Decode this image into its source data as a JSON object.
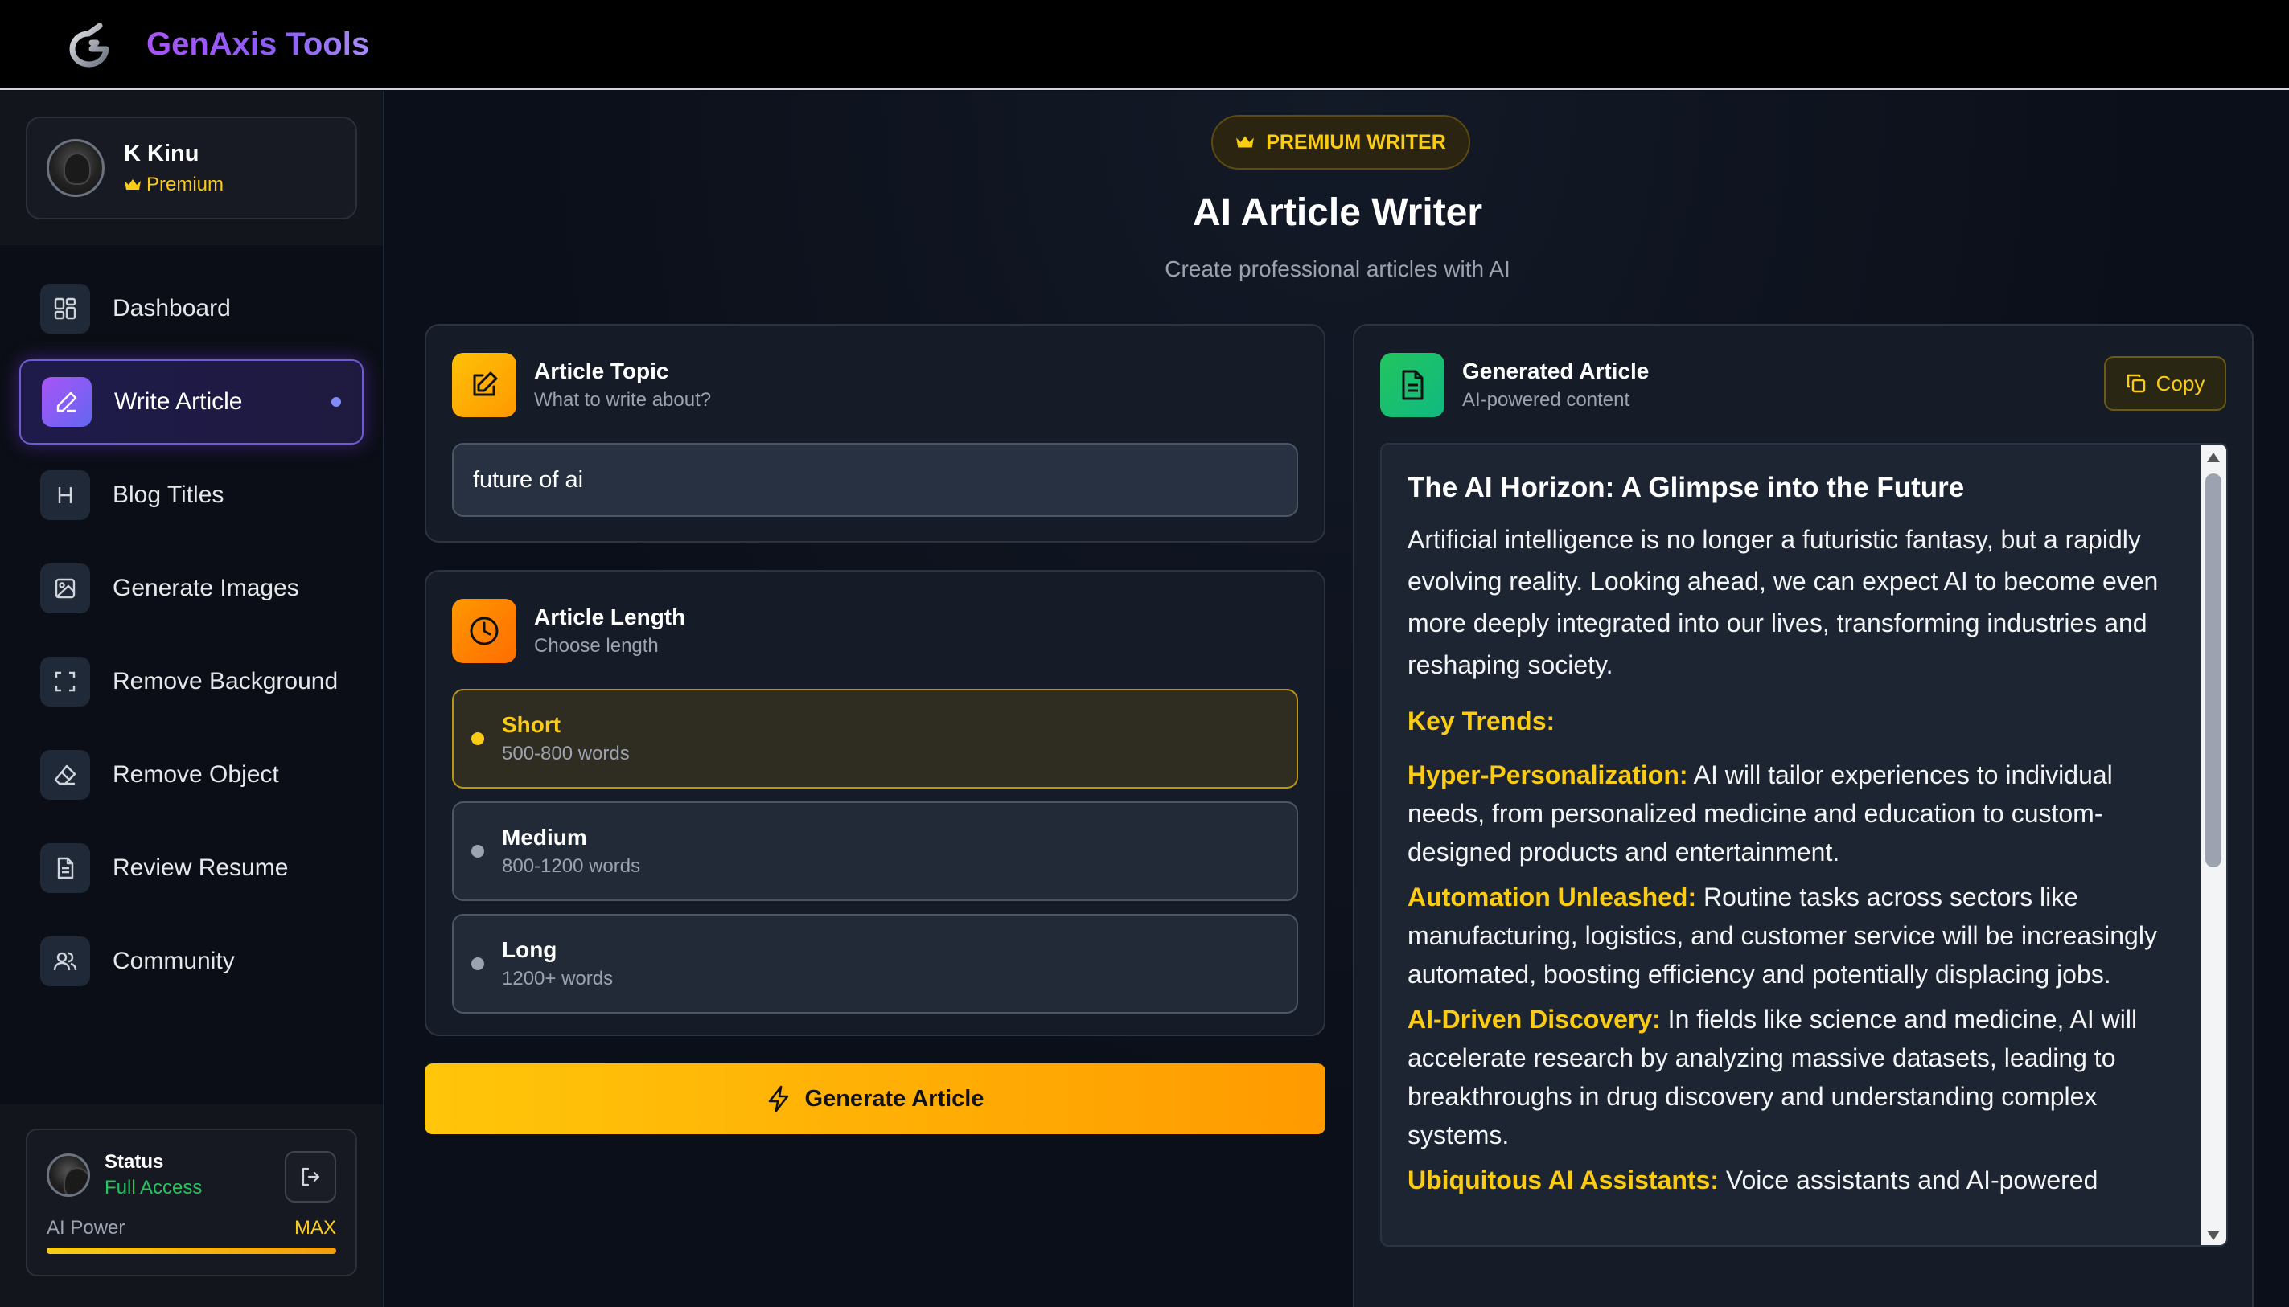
{
  "app": {
    "brand": "GenAxis Tools"
  },
  "profile": {
    "name": "K Kinu",
    "plan": "Premium"
  },
  "sidebar": {
    "items": [
      {
        "label": "Dashboard",
        "icon": "dashboard-icon"
      },
      {
        "label": "Write Article",
        "icon": "pen-icon",
        "active": true
      },
      {
        "label": "Blog Titles",
        "icon": "heading-icon"
      },
      {
        "label": "Generate Images",
        "icon": "image-icon"
      },
      {
        "label": "Remove Background",
        "icon": "scan-icon"
      },
      {
        "label": "Remove Object",
        "icon": "eraser-icon"
      },
      {
        "label": "Review Resume",
        "icon": "document-icon"
      },
      {
        "label": "Community",
        "icon": "users-icon"
      }
    ]
  },
  "status": {
    "title": "Status",
    "access": "Full Access",
    "power_label": "AI Power",
    "power_value": "MAX",
    "power_fill": 1.0
  },
  "header": {
    "badge": "PREMIUM WRITER",
    "title": "AI Article Writer",
    "subtitle": "Create professional articles with AI"
  },
  "topic": {
    "title": "Article Topic",
    "subtitle": "What to write about?",
    "value": "future of ai"
  },
  "length": {
    "title": "Article Length",
    "subtitle": "Choose length",
    "options": [
      {
        "name": "Short",
        "desc": "500-800 words",
        "selected": true
      },
      {
        "name": "Medium",
        "desc": "800-1200 words",
        "selected": false
      },
      {
        "name": "Long",
        "desc": "1200+ words",
        "selected": false
      }
    ]
  },
  "generate": {
    "label": "Generate Article"
  },
  "output": {
    "title": "Generated Article",
    "subtitle": "AI-powered content",
    "copy_label": "Copy",
    "article": {
      "heading": "The AI Horizon: A Glimpse into the Future",
      "intro": "Artificial intelligence is no longer a futuristic fantasy, but a rapidly evolving reality. Looking ahead, we can expect AI to become even more deeply integrated into our lives, transforming industries and reshaping society.",
      "section": "Key Trends:",
      "items": [
        {
          "term": "Hyper-Personalization:",
          "text": " AI will tailor experiences to individual needs, from personalized medicine and education to custom-designed products and entertainment."
        },
        {
          "term": "Automation Unleashed:",
          "text": " Routine tasks across sectors like manufacturing, logistics, and customer service will be increasingly automated, boosting efficiency and potentially displacing jobs."
        },
        {
          "term": "AI-Driven Discovery:",
          "text": " In fields like science and medicine, AI will accelerate research by analyzing massive datasets, leading to breakthroughs in drug discovery and understanding complex systems."
        },
        {
          "term": "Ubiquitous AI Assistants:",
          "text": " Voice assistants and AI-powered"
        }
      ]
    }
  },
  "colors": {
    "accent_yellow": "#facc15",
    "accent_purple": "#8b5cf6",
    "success_green": "#22c55e",
    "background": "#0b0f19"
  }
}
